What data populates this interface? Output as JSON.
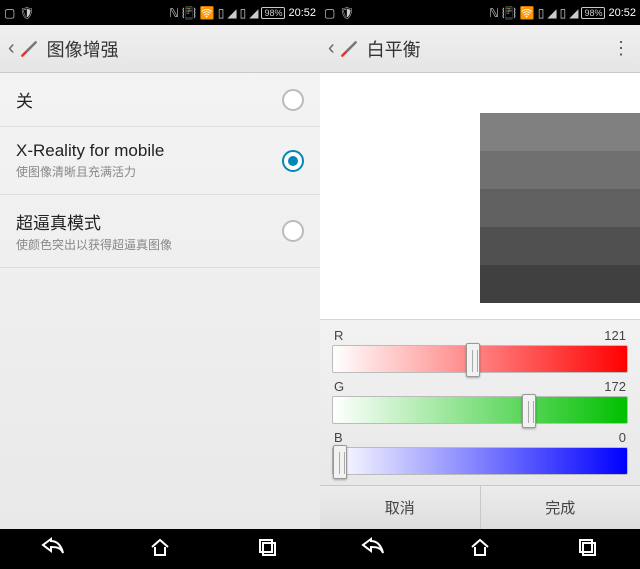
{
  "status": {
    "battery": "98%",
    "time": "20:52"
  },
  "left": {
    "title": "图像增强",
    "options": [
      {
        "title": "关",
        "sub": "",
        "selected": false
      },
      {
        "title": "X-Reality for mobile",
        "sub": "使图像清晰且充满活力",
        "selected": true
      },
      {
        "title": "超逼真模式",
        "sub": "使颜色突出以获得超逼真图像",
        "selected": false
      }
    ]
  },
  "right": {
    "title": "白平衡",
    "channels": {
      "r": {
        "label": "R",
        "value": 121,
        "max": 255
      },
      "g": {
        "label": "G",
        "value": 172,
        "max": 255
      },
      "b": {
        "label": "B",
        "value": 0,
        "max": 255
      }
    },
    "buttons": {
      "cancel": "取消",
      "done": "完成"
    }
  }
}
